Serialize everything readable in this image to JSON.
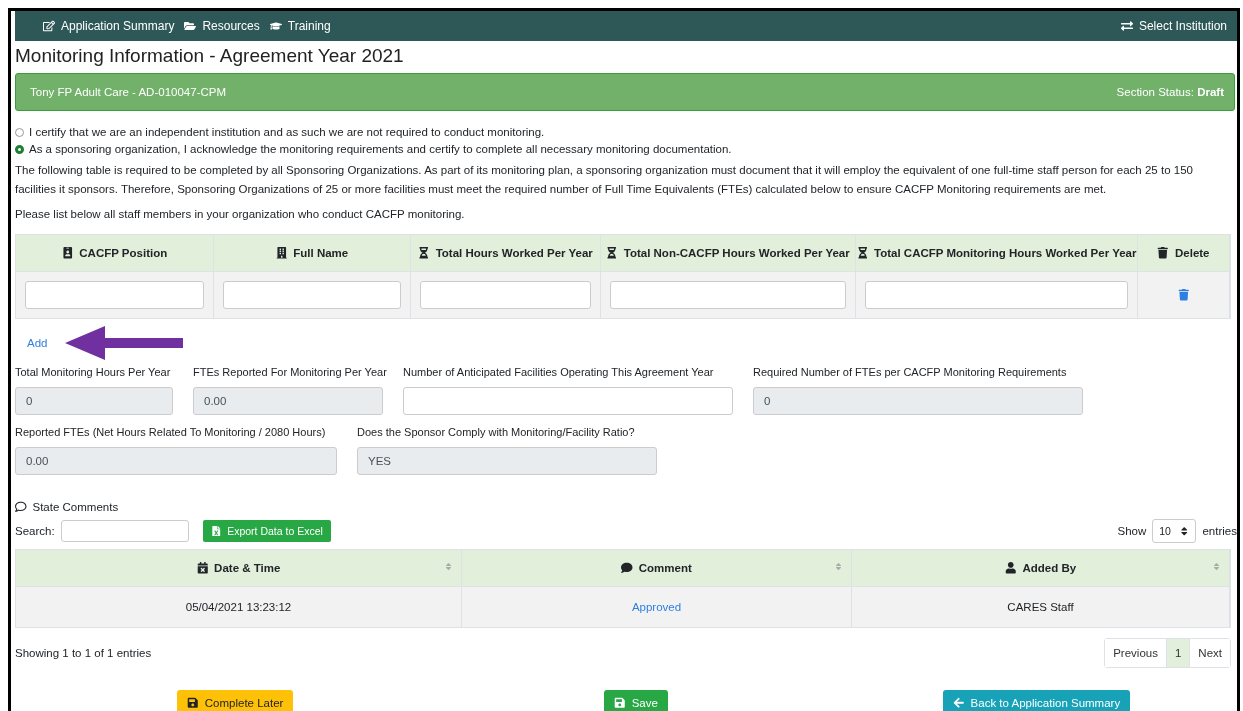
{
  "nav": {
    "items": [
      {
        "label": "Application Summary"
      },
      {
        "label": "Resources"
      },
      {
        "label": "Training"
      }
    ],
    "right": "Select Institution"
  },
  "title": "Monitoring Information - Agreement Year 2021",
  "banner": {
    "name": "Tony FP Adult Care - AD-010047-CPM",
    "status_label": "Section Status:",
    "status_value": "Draft"
  },
  "radios": [
    {
      "label": "I certify that we are an independent institution and as such we are not required to conduct monitoring.",
      "selected": false
    },
    {
      "label": "As a sponsoring organization, I acknowledge the monitoring requirements and certify to complete all necessary monitoring documentation.",
      "selected": true
    }
  ],
  "paragraphs": [
    "The following table is required to be completed by all Sponsoring Organizations. As part of its monitoring plan, a sponsoring organization must document that it will employ the equivalent of one full-time staff person for each 25 to 150 facilities it sponsors. Therefore, Sponsoring Organizations of 25 or more facilities must meet the required number of Full Time Equivalents (FTEs) calculated below to ensure CACFP Monitoring requirements are met.",
    "Please list below all staff members in your organization who conduct CACFP monitoring."
  ],
  "staff_table": {
    "columns": [
      {
        "label": "CACFP Position",
        "kind": "input"
      },
      {
        "label": "Full Name",
        "kind": "input"
      },
      {
        "label": "Total Hours Worked Per Year",
        "kind": "input"
      },
      {
        "label": "Total Non-CACFP Hours Worked Per Year",
        "kind": "input"
      },
      {
        "label": "Total CACFP Monitoring Hours Worked Per Year",
        "kind": "input"
      },
      {
        "label": "Delete",
        "kind": "delete"
      }
    ],
    "rows": [
      {
        "kind": "blank"
      }
    ]
  },
  "add_link": "Add",
  "field_rows": [
    [
      {
        "label": "Total Monitoring Hours Per Year",
        "value": "0",
        "readonly": true
      },
      {
        "label": "FTEs Reported For Monitoring Per Year",
        "value": "0.00",
        "readonly": true
      },
      {
        "label": "Number of Anticipated Facilities Operating This Agreement Year",
        "readonly": false
      },
      {
        "label": "Required Number of FTEs per CACFP Monitoring Requirements",
        "value": "0",
        "readonly": true
      }
    ],
    [
      {
        "label": "Reported FTEs (Net Hours Related To Monitoring / 2080 Hours)",
        "value": "0.00",
        "readonly": true
      },
      {
        "label": "Does the Sponsor Comply with Monitoring/Facility Ratio?",
        "value": "YES",
        "readonly": true
      }
    ]
  ],
  "comments": {
    "title": "State Comments",
    "search_label": "Search:",
    "export_label": "Export Data to Excel",
    "show_label": "Show",
    "show_value": "10",
    "entries_label": "entries",
    "columns": [
      {
        "label": "Date & Time"
      },
      {
        "label": "Comment"
      },
      {
        "label": "Added By"
      }
    ],
    "rows": [
      {
        "cells": [
          {
            "text": "05/04/2021 13:23:12",
            "kind": "text"
          },
          {
            "text": "Approved",
            "kind": "link"
          },
          {
            "text": "CARES Staff",
            "kind": "text"
          }
        ]
      }
    ],
    "info": "Showing 1 to 1 of 1 entries",
    "pagination": [
      {
        "label": "Previous",
        "selected": false
      },
      {
        "label": "1",
        "selected": true
      },
      {
        "label": "Next",
        "selected": false
      }
    ]
  },
  "buttons": [
    {
      "label": "Complete Later",
      "kind": "warning"
    },
    {
      "label": "Save",
      "kind": "success"
    },
    {
      "label": "Back to Application Summary",
      "kind": "info"
    }
  ]
}
